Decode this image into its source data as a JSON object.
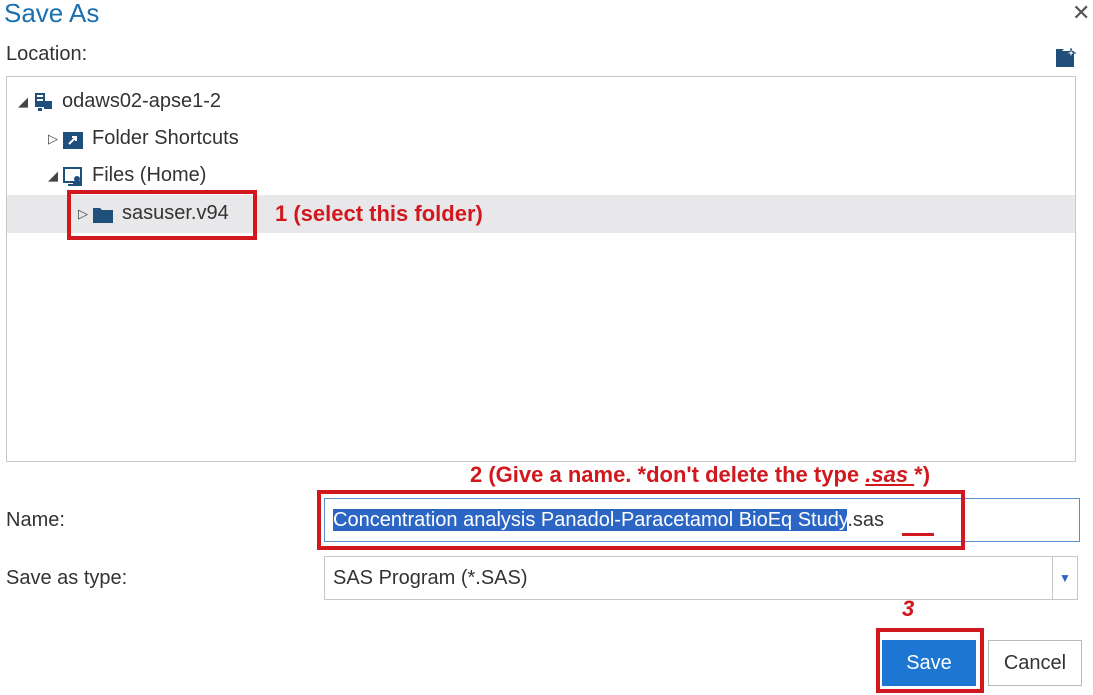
{
  "dialog": {
    "title": "Save As",
    "close_symbol": "✕"
  },
  "location": {
    "label": "Location:"
  },
  "tree": {
    "root": "odaws02-apse1-2",
    "folder_shortcuts": "Folder Shortcuts",
    "files_home": "Files (Home)",
    "sasuser": "sasuser.v94"
  },
  "name": {
    "label": "Name:",
    "value_selected": "Concentration analysis Panadol-Paracetamol BioEq Study",
    "value_ext": ".sas"
  },
  "type": {
    "label": "Save as type:",
    "value": "SAS Program (*.SAS)"
  },
  "buttons": {
    "save": "Save",
    "cancel": "Cancel"
  },
  "annotations": {
    "step1": "1 (select this folder)",
    "step2_pre": "2 (Give a name. *don't delete the type ",
    "step2_ext": ".sas ",
    "step2_post": "*)",
    "step3": "3"
  },
  "colors": {
    "accent": "#1c76d2",
    "annotation": "#d0181e",
    "selection": "#2c66c4"
  }
}
